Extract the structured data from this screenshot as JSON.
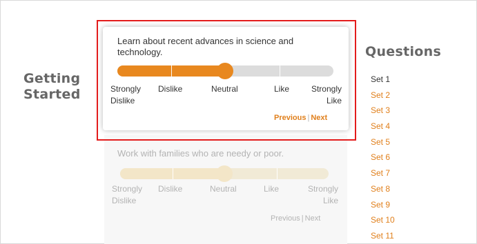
{
  "sidebar": {
    "title": "Getting Started"
  },
  "active_question": {
    "prompt": "Learn about recent advances in science and technology.",
    "value": 0.5,
    "scale": [
      "Strongly Dislike",
      "Dislike",
      "Neutral",
      "Like",
      "Strongly Like"
    ],
    "previous_label": "Previous",
    "next_label": "Next"
  },
  "next_question": {
    "prompt": "Work with families who are needy or poor.",
    "value": 0.5,
    "scale": [
      "Strongly Dislike",
      "Dislike",
      "Neutral",
      "Like",
      "Strongly Like"
    ],
    "previous_label": "Previous",
    "next_label": "Next"
  },
  "questions_panel": {
    "title": "Questions",
    "current_index": 0,
    "sets": [
      "Set 1",
      "Set 2",
      "Set 3",
      "Set 4",
      "Set 5",
      "Set 6",
      "Set 7",
      "Set 8",
      "Set 9",
      "Set 10",
      "Set 11"
    ]
  },
  "colors": {
    "accent": "#e8881f",
    "link": "#e07f1b",
    "highlight_border": "#e31b1b",
    "heading": "#666666",
    "muted": "#b3b3b3"
  }
}
